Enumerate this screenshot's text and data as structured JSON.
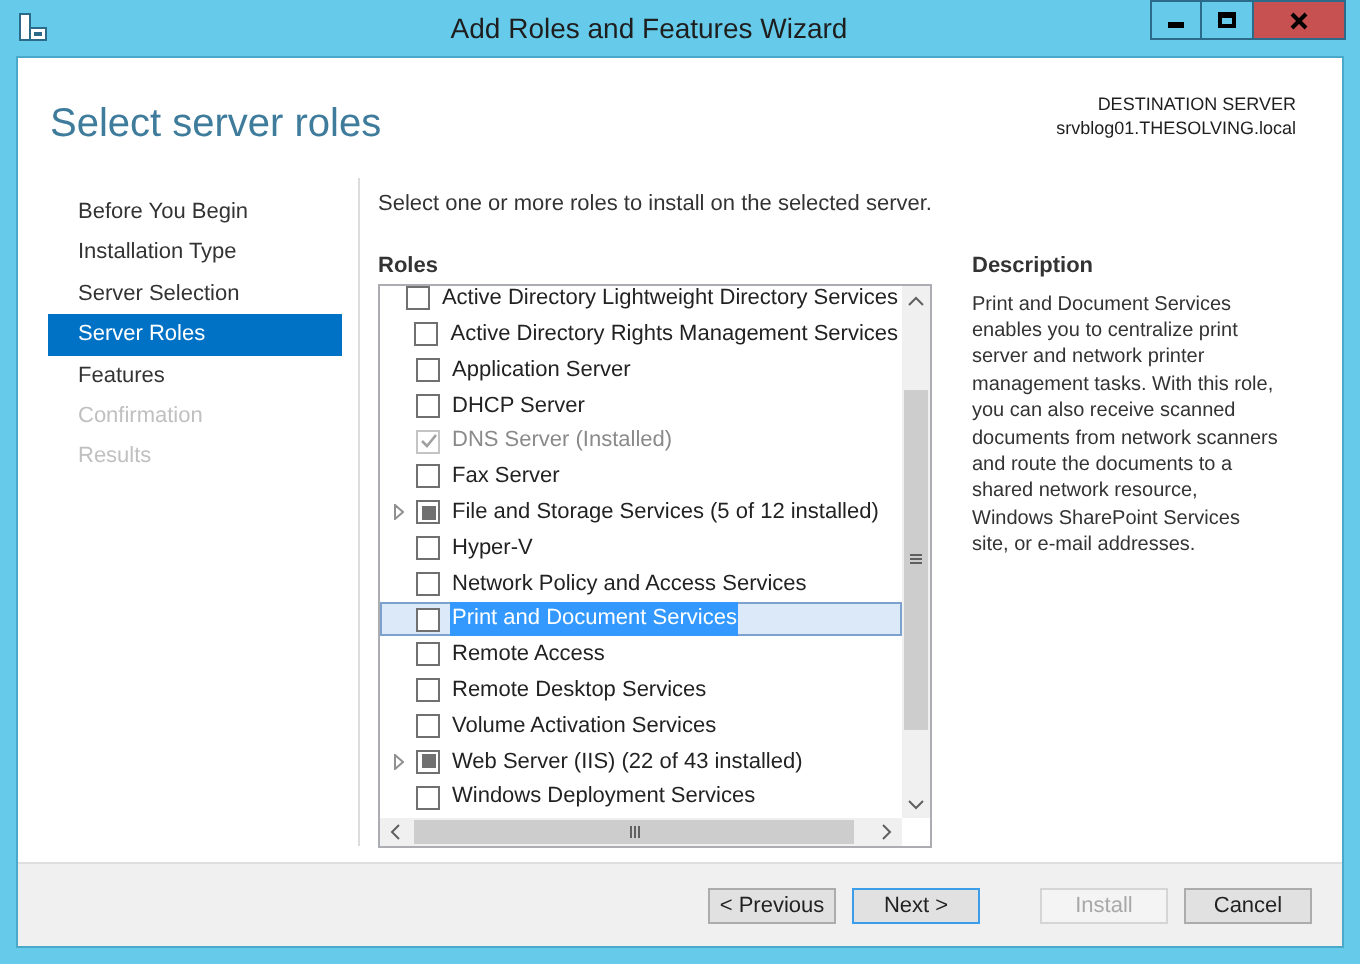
{
  "window": {
    "title": "Add Roles and Features Wizard"
  },
  "header": {
    "title": "Select server roles",
    "destination_label": "DESTINATION SERVER",
    "destination_server": "srvblog01.THESOLVING.local"
  },
  "nav": [
    {
      "label": "Before You Begin",
      "selected": false,
      "disabled": false
    },
    {
      "label": "Installation Type",
      "selected": false,
      "disabled": false
    },
    {
      "label": "Server Selection",
      "selected": false,
      "disabled": false
    },
    {
      "label": "Server Roles",
      "selected": true,
      "disabled": false
    },
    {
      "label": "Features",
      "selected": false,
      "disabled": false
    },
    {
      "label": "Confirmation",
      "selected": false,
      "disabled": true
    },
    {
      "label": "Results",
      "selected": false,
      "disabled": true
    }
  ],
  "intro": "Select one or more roles to install on the selected server.",
  "roles_heading": "Roles",
  "roles": [
    {
      "label": "Active Directory Lightweight Directory Services",
      "kind": "unchecked",
      "disabled": false,
      "expandable": false,
      "selected": false
    },
    {
      "label": "Active Directory Rights Management Services",
      "kind": "unchecked",
      "disabled": false,
      "expandable": false,
      "selected": false
    },
    {
      "label": "Application Server",
      "kind": "unchecked",
      "disabled": false,
      "expandable": false,
      "selected": false
    },
    {
      "label": "DHCP Server",
      "kind": "unchecked",
      "disabled": false,
      "expandable": false,
      "selected": false
    },
    {
      "label": "DNS Server (Installed)",
      "kind": "checked",
      "disabled": true,
      "expandable": false,
      "selected": false
    },
    {
      "label": "Fax Server",
      "kind": "unchecked",
      "disabled": false,
      "expandable": false,
      "selected": false
    },
    {
      "label": "File and Storage Services (5 of 12 installed)",
      "kind": "partial",
      "disabled": false,
      "expandable": true,
      "selected": false
    },
    {
      "label": "Hyper-V",
      "kind": "unchecked",
      "disabled": false,
      "expandable": false,
      "selected": false
    },
    {
      "label": "Network Policy and Access Services",
      "kind": "unchecked",
      "disabled": false,
      "expandable": false,
      "selected": false
    },
    {
      "label": "Print and Document Services",
      "kind": "unchecked",
      "disabled": false,
      "expandable": false,
      "selected": true
    },
    {
      "label": "Remote Access",
      "kind": "unchecked",
      "disabled": false,
      "expandable": false,
      "selected": false
    },
    {
      "label": "Remote Desktop Services",
      "kind": "unchecked",
      "disabled": false,
      "expandable": false,
      "selected": false
    },
    {
      "label": "Volume Activation Services",
      "kind": "unchecked",
      "disabled": false,
      "expandable": false,
      "selected": false
    },
    {
      "label": "Web Server (IIS) (22 of 43 installed)",
      "kind": "partial",
      "disabled": false,
      "expandable": true,
      "selected": false
    },
    {
      "label": "Windows Deployment Services",
      "kind": "unchecked",
      "disabled": false,
      "expandable": false,
      "selected": false
    }
  ],
  "description": {
    "heading": "Description",
    "text": "Print and Document Services enables you to centralize print server and network printer management tasks. With this role, you can also receive scanned documents from network scanners and route the documents to a shared network resource, Windows SharePoint Services site, or e-mail addresses."
  },
  "buttons": [
    {
      "label": "< Previous",
      "disabled": false,
      "default": false
    },
    {
      "label": "Next >",
      "disabled": false,
      "default": true
    },
    {
      "label": "Install",
      "disabled": true,
      "default": false
    },
    {
      "label": "Cancel",
      "disabled": false,
      "default": false
    }
  ]
}
